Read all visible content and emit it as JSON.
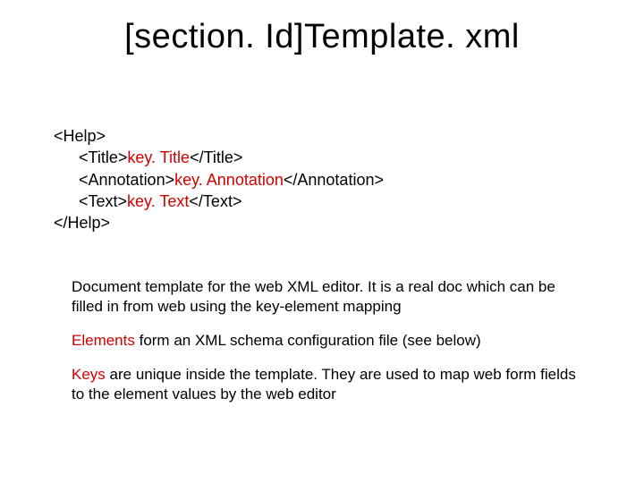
{
  "title": "[section. Id]Template. xml",
  "xml": {
    "open_help": "<Help>",
    "title_open": "<Title>",
    "title_key": "key. Title",
    "title_close": "</Title>",
    "ann_open": "<Annotation>",
    "ann_key": "key. Annotation",
    "ann_close": "</Annotation>",
    "text_open": "<Text>",
    "text_key": "key. Text",
    "text_close": "</Text>",
    "close_help": "</Help>"
  },
  "para1": "Document template for the web XML editor. It is a real doc which can be filled in from web using the key-element mapping",
  "para2_lead": "Elements",
  "para2_rest": " form an XML schema configuration file (see below)",
  "para3_lead": "Keys",
  "para3_rest": " are unique inside the template. They are used to map web form fields to the element values by the web editor"
}
